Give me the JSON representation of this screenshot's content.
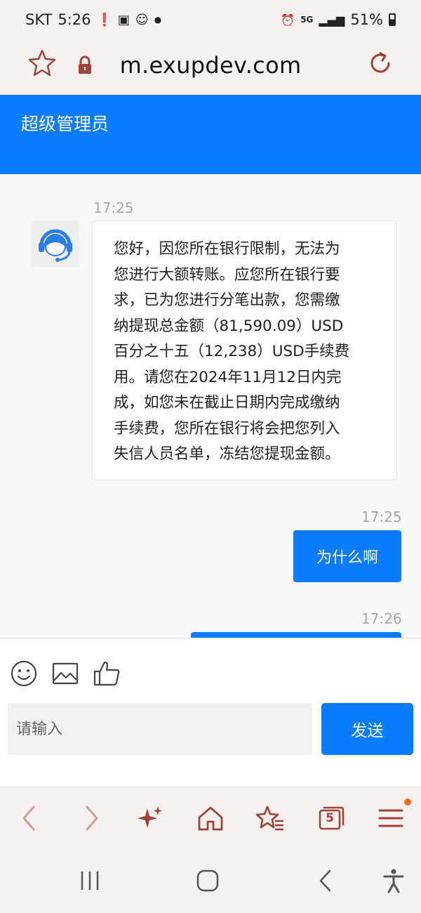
{
  "status_bar": {
    "carrier": "SKT",
    "time": "5:26",
    "battery": "51%"
  },
  "browser": {
    "url": "m.exupdev.com",
    "tab_count": "5"
  },
  "header": {
    "title": "超级管理员"
  },
  "chat": {
    "messages": [
      {
        "time": "17:25",
        "direction": "incoming",
        "lines": [
          "您好，因您所在银行限制，无法为",
          "您进行大额转账。应您所在银行要",
          "求，已为您进行分笔出款，您需缴",
          "纳提现总金额（81,590.09）USD",
          "百分之十五（12,238）USD手续费",
          "用。请您在2024年11月12日内完",
          "成，如您未在截止日期内完成缴纳",
          "手续费，您所在银行将会把您列入",
          "失信人员名单，冻结您提现金额。"
        ]
      },
      {
        "time": "17:25",
        "direction": "outgoing",
        "text": "为什么啊"
      },
      {
        "time": "17:26",
        "direction": "outgoing",
        "text": ""
      }
    ]
  },
  "composer": {
    "placeholder": "请输入",
    "send_label": "发送"
  },
  "colors": {
    "accent": "#0a7cff",
    "browser_icon": "#a0413b",
    "notification_dot": "#ff6a2a"
  }
}
